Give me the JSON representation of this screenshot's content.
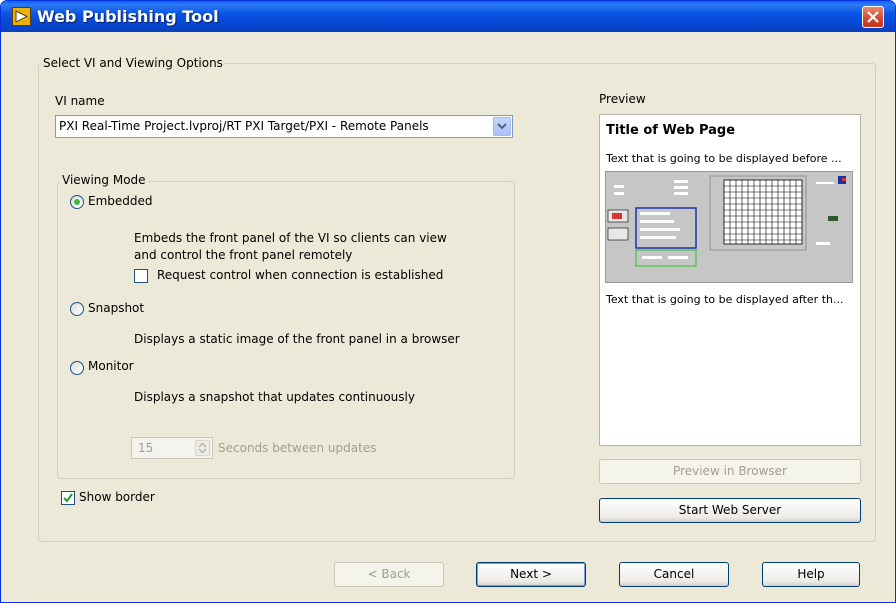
{
  "window": {
    "title": "Web Publishing Tool"
  },
  "group_main": {
    "label": "Select VI and Viewing Options"
  },
  "vi": {
    "label": "VI name",
    "value": "PXI Real-Time Project.lvproj/RT PXI Target/PXI - Remote Panels"
  },
  "viewing_mode": {
    "label": "Viewing Mode",
    "selected": "Embedded",
    "embedded": {
      "label": "Embedded",
      "desc_line1": "Embeds the front panel of the VI so clients can view",
      "desc_line2": "and control the front panel remotely",
      "request_control_label": "Request control when connection is established",
      "request_control_checked": false
    },
    "snapshot": {
      "label": "Snapshot",
      "desc": "Displays a static image of the front panel in a browser"
    },
    "monitor": {
      "label": "Monitor",
      "desc": "Displays a snapshot that updates continuously"
    },
    "update_seconds": "15",
    "update_label": "Seconds between updates"
  },
  "show_border": {
    "label": "Show border",
    "checked": true
  },
  "preview": {
    "label": "Preview",
    "page_title": "Title of Web Page",
    "text_before": "Text that is going to be displayed before ...",
    "text_after": "Text that is going to be displayed after th..."
  },
  "buttons": {
    "preview_in_browser": "Preview in Browser",
    "start_web_server": "Start Web Server",
    "back": "< Back",
    "next": "Next >",
    "cancel": "Cancel",
    "help": "Help"
  }
}
